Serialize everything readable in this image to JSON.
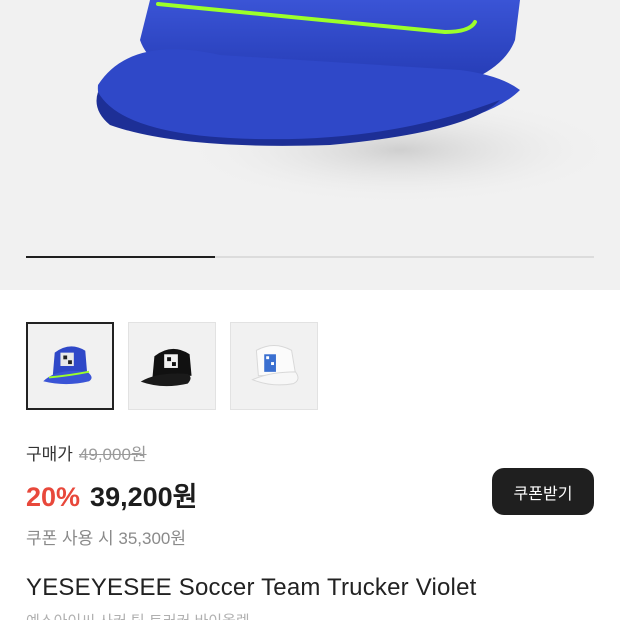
{
  "gallery": {
    "progress_fraction": 0.333,
    "colors": {
      "background": "#f1f1f1",
      "cap_blue": "#2f48c8",
      "cap_blue_dark": "#1f34a3",
      "rope_green": "#9cff2a"
    },
    "thumbnails": [
      {
        "variant": "blue-cap",
        "selected": true
      },
      {
        "variant": "black-cap",
        "selected": false
      },
      {
        "variant": "white-cap",
        "selected": false
      }
    ]
  },
  "price": {
    "buy_label": "구매가",
    "original_price": "49,000원",
    "discount_rate": "20%",
    "sale_price": "39,200원",
    "coupon_price_text": "쿠폰 사용 시 35,300원",
    "discount_color": "#e8483b"
  },
  "coupon_button": {
    "label": "쿠폰받기"
  },
  "product": {
    "title": "YESEYESEE Soccer Team Trucker Violet",
    "subtitle": "예스아이씨 사커 팀 트러커 바이올렛"
  }
}
